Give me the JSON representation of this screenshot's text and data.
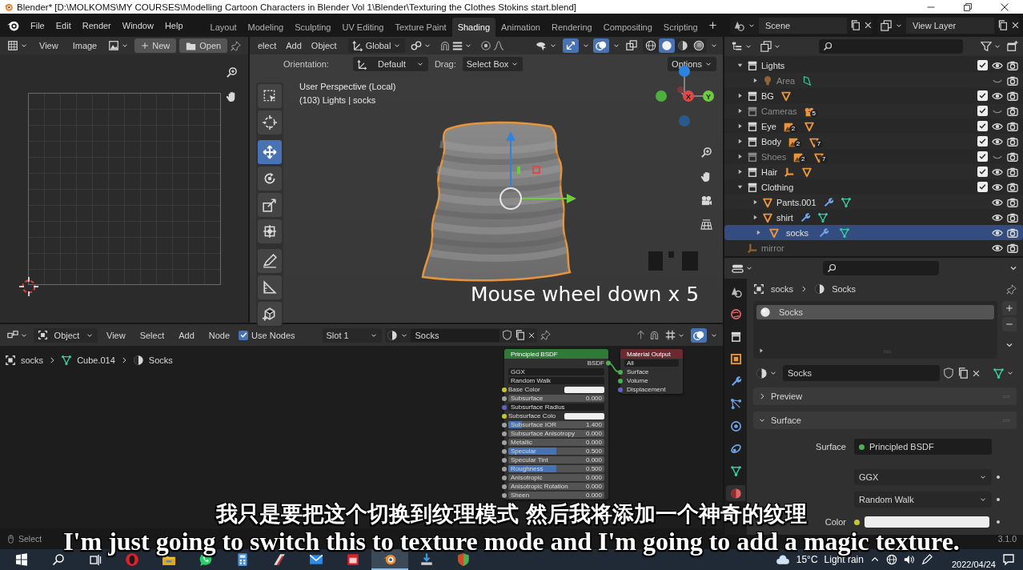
{
  "window": {
    "title": "Blender* [D:\\MOLKOMS\\MY COURSES\\Modelling  Cartoon Characters in Blender Vol 1\\Blender\\Texturing the Clothes Stokins start.blend]"
  },
  "menu": [
    "File",
    "Edit",
    "Render",
    "Window",
    "Help"
  ],
  "workspace_tabs": [
    {
      "label": "Layout",
      "selected": false
    },
    {
      "label": "Modeling",
      "selected": false
    },
    {
      "label": "Sculpting",
      "selected": false
    },
    {
      "label": "UV Editing",
      "selected": false
    },
    {
      "label": "Texture Paint",
      "selected": false
    },
    {
      "label": "Shading",
      "selected": true
    },
    {
      "label": "Animation",
      "selected": false
    },
    {
      "label": "Rendering",
      "selected": false
    },
    {
      "label": "Compositing",
      "selected": false
    },
    {
      "label": "Scripting",
      "selected": false
    }
  ],
  "scene": {
    "name": "Scene"
  },
  "view_layer": {
    "name": "View Layer"
  },
  "image_editor": {
    "menus": [
      "View",
      "Image"
    ],
    "new_button": "New",
    "open_button": "Open"
  },
  "viewport": {
    "menus": [
      "elect",
      "Add",
      "Object"
    ],
    "transform_orientation": "Global",
    "shading": [
      {
        "kind": "wireframe",
        "selected": false
      },
      {
        "kind": "solid",
        "selected": true
      },
      {
        "kind": "material",
        "selected": false
      },
      {
        "kind": "rendered",
        "selected": false
      }
    ],
    "options": "Options",
    "orientation_label": "Orientation:",
    "orientation": "Default",
    "drag_label": "Drag:",
    "drag": "Select Box",
    "view_name": "User Perspective (Local)",
    "view_info": "(103) Lights | socks",
    "tools": [
      {
        "kind": "select",
        "selected": false
      },
      {
        "kind": "cursor",
        "selected": false
      },
      {
        "kind": "move",
        "selected": true
      },
      {
        "kind": "rotate",
        "selected": false
      },
      {
        "kind": "scale",
        "selected": false
      },
      {
        "kind": "transform",
        "selected": false
      },
      {
        "kind": "annotate",
        "selected": false
      },
      {
        "kind": "measure",
        "selected": false
      },
      {
        "kind": "addcube",
        "selected": false
      }
    ],
    "gizmo": {
      "x": "X",
      "y": "Y"
    },
    "key_overlay": "Mouse wheel down x 5"
  },
  "node_editor": {
    "mode": "Object",
    "menus": [
      "View",
      "Select",
      "Add",
      "Node"
    ],
    "use_nodes": {
      "label": "Use Nodes",
      "checked": true
    },
    "slot": "Slot 1",
    "material": "Socks",
    "breadcrumb": [
      "socks",
      "Cube.014",
      "Socks"
    ],
    "principled": {
      "title": "Principled BSDF",
      "output": "BSDF",
      "rows": [
        {
          "kind": "dropdown",
          "label": "GGX"
        },
        {
          "kind": "dropdown",
          "label": "Random Walk"
        },
        {
          "kind": "color",
          "label": "Base Color"
        },
        {
          "kind": "slider",
          "label": "Subsurface",
          "value": "0.000"
        },
        {
          "kind": "vector",
          "label": "Subsurface Radius"
        },
        {
          "kind": "color",
          "label": "Subsurface Colo"
        },
        {
          "kind": "slider",
          "label": "Subsurface IOR",
          "value": "1.400",
          "level": 0.14
        },
        {
          "kind": "slider",
          "label": "Subsurface Anisotropy",
          "value": "0.000"
        },
        {
          "kind": "slider",
          "label": "Metallic",
          "value": "0.000"
        },
        {
          "kind": "slider",
          "label": "Specular",
          "value": "0.500",
          "level": 0.5
        },
        {
          "kind": "slider",
          "label": "Specular Tint",
          "value": "0.000"
        },
        {
          "kind": "slider",
          "label": "Roughness",
          "value": "0.500",
          "level": 0.5
        },
        {
          "kind": "slider",
          "label": "Anisotropic",
          "value": "0.000"
        },
        {
          "kind": "slider",
          "label": "Anisotropic Rotation",
          "value": "0.000"
        },
        {
          "kind": "slider",
          "label": "Sheen",
          "value": "0.000"
        }
      ]
    },
    "output": {
      "title": "Material Output",
      "target": "All",
      "inputs": [
        {
          "kind": "shader",
          "label": "Surface"
        },
        {
          "kind": "shader",
          "label": "Volume"
        },
        {
          "kind": "vector",
          "label": "Displacement"
        }
      ]
    }
  },
  "outliner": {
    "rows": [
      {
        "label": "Lights",
        "kind": "collection",
        "expanded": true,
        "checked": true,
        "visible": true,
        "dim": false,
        "selected": false,
        "badges": [],
        "children": [
          {
            "label": "Area",
            "kind": "light",
            "expanded": false,
            "visible": false,
            "dim": true,
            "selected": false,
            "badges": [
              {
                "kind": "lightdata"
              }
            ]
          }
        ]
      },
      {
        "label": "BG",
        "kind": "collection",
        "expanded": false,
        "checked": true,
        "visible": true,
        "dim": false,
        "selected": false,
        "badges": [
          {
            "kind": "mesh"
          }
        ]
      },
      {
        "label": "Cameras",
        "kind": "collection",
        "expanded": false,
        "checked": true,
        "visible": false,
        "dim": true,
        "selected": false,
        "badges": [
          {
            "kind": "camera",
            "count": "5"
          }
        ]
      },
      {
        "label": "Eye",
        "kind": "collection",
        "expanded": false,
        "checked": true,
        "visible": true,
        "dim": false,
        "selected": false,
        "badges": [
          {
            "kind": "image",
            "count": "2"
          },
          {
            "kind": "mesh"
          }
        ]
      },
      {
        "label": "Body",
        "kind": "collection",
        "expanded": false,
        "checked": true,
        "visible": true,
        "dim": false,
        "selected": false,
        "badges": [
          {
            "kind": "image",
            "count": "2"
          },
          {
            "kind": "mesh",
            "count": "7"
          }
        ]
      },
      {
        "label": "Shoes",
        "kind": "collection",
        "expanded": false,
        "checked": true,
        "visible": false,
        "dim": true,
        "selected": false,
        "badges": [
          {
            "kind": "image",
            "count": "2"
          },
          {
            "kind": "mesh",
            "count": "7"
          }
        ]
      },
      {
        "label": "Hair",
        "kind": "collection",
        "expanded": false,
        "checked": true,
        "visible": true,
        "dim": false,
        "selected": false,
        "badges": [
          {
            "kind": "empty"
          },
          {
            "kind": "mesh"
          }
        ]
      },
      {
        "label": "Clothing",
        "kind": "collection",
        "expanded": true,
        "checked": true,
        "visible": true,
        "dim": false,
        "selected": false,
        "badges": [],
        "children": [
          {
            "label": "Pants.001",
            "kind": "mesh",
            "expanded": false,
            "visible": true,
            "dim": false,
            "selected": false,
            "badges": [
              {
                "kind": "wrench"
              },
              {
                "kind": "meshdata"
              }
            ]
          },
          {
            "label": "shirt",
            "kind": "mesh",
            "expanded": false,
            "visible": true,
            "dim": false,
            "selected": false,
            "badges": [
              {
                "kind": "wrench"
              },
              {
                "kind": "meshdata"
              }
            ]
          },
          {
            "label": "socks",
            "kind": "mesh",
            "expanded": false,
            "visible": true,
            "dim": false,
            "selected": true,
            "badges": [
              {
                "kind": "wrench"
              },
              {
                "kind": "meshdata"
              }
            ]
          }
        ]
      },
      {
        "label": "mirror",
        "kind": "empty",
        "visible": true,
        "dim": true,
        "selected": false,
        "badges": []
      }
    ]
  },
  "properties": {
    "tabs": [
      {
        "kind": "scene",
        "selected": false
      },
      {
        "kind": "world",
        "selected": false
      },
      {
        "kind": "collection",
        "selected": false
      },
      {
        "kind": "object",
        "selected": false
      },
      {
        "kind": "modifier",
        "selected": false
      },
      {
        "kind": "particles",
        "selected": false
      },
      {
        "kind": "physics",
        "selected": false
      },
      {
        "kind": "constraints",
        "selected": false
      },
      {
        "kind": "data",
        "selected": false
      },
      {
        "kind": "material",
        "selected": true
      }
    ],
    "breadcrumb": [
      "socks",
      "Socks"
    ],
    "slots": [
      {
        "label": "Socks",
        "selected": true
      }
    ],
    "material": "Socks",
    "sections": [
      {
        "label": "Preview",
        "expanded": false
      },
      {
        "label": "Surface",
        "expanded": true
      }
    ],
    "surface_label": "Surface",
    "surface": "Principled BSDF",
    "distribution": "GGX",
    "subsurface_method": "Random Walk",
    "base_color_label": "Color"
  },
  "status_bar": {
    "items": [
      "Select"
    ],
    "version": "3.1.0"
  },
  "taskbar": {
    "apps": [
      {
        "kind": "opera",
        "selected": false
      },
      {
        "kind": "explorer",
        "selected": false
      },
      {
        "kind": "whatsapp",
        "selected": false
      },
      {
        "kind": "calculator",
        "selected": false
      },
      {
        "kind": "racing",
        "selected": false
      },
      {
        "kind": "mail",
        "selected": false
      },
      {
        "kind": "calendar",
        "selected": false
      },
      {
        "kind": "blender",
        "selected": true
      },
      {
        "kind": "installer",
        "selected": false
      },
      {
        "kind": "shield",
        "selected": false
      }
    ],
    "temperature": "15°C",
    "weather": "Light rain",
    "date": "2022/04/24"
  },
  "subtitles": {
    "chinese": "我只是要把这个切换到纹理模式 然后我将添加一个神奇的纹理",
    "english": "I'm just going to switch this to texture mode and I'm going to add a magic texture."
  }
}
